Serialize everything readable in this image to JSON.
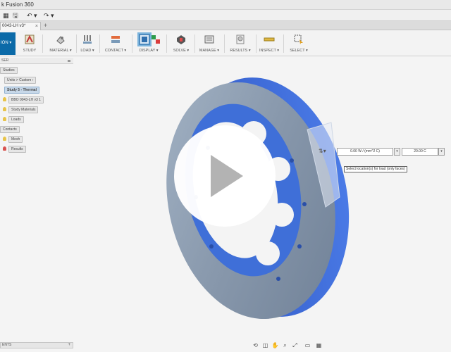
{
  "title": "k Fusion 360",
  "quick_access": {
    "save": "🖫",
    "undo": "↶ ▾",
    "redo": "↷ ▾"
  },
  "document_tab": {
    "label": "0043-LH v3*",
    "close": "×",
    "add": "+"
  },
  "workspace": {
    "label": "ION ▾"
  },
  "toolbar": [
    {
      "label": "STUDY",
      "icon": "study-icon"
    },
    {
      "label": "MATERIAL ▾",
      "icon": "material-icon"
    },
    {
      "label": "LOAD ▾",
      "icon": "load-icon"
    },
    {
      "label": "CONTACT ▾",
      "icon": "contact-icon"
    },
    {
      "label": "DISPLAY ▾",
      "icon": "display-icon",
      "selected": true
    },
    {
      "label": "SOLVE ▾",
      "icon": "solve-icon"
    },
    {
      "label": "MANAGE ▾",
      "icon": "manage-icon"
    },
    {
      "label": "RESULTS ▾",
      "icon": "results-icon"
    },
    {
      "label": "INSPECT ▾",
      "icon": "inspect-icon"
    },
    {
      "label": "SELECT ▾",
      "icon": "select-icon"
    }
  ],
  "browser": {
    "header": "SER",
    "nodes": [
      {
        "label": "Studies"
      },
      {
        "label": "Units > Custom ›"
      },
      {
        "label": "Study 5 - Thermal",
        "selected": true
      },
      {
        "label": "BBO 0043-LH v3 1"
      },
      {
        "label": "Study Materials"
      },
      {
        "label": "Loads"
      },
      {
        "label": "Contacts"
      },
      {
        "label": "Mesh"
      },
      {
        "label": "Results"
      }
    ]
  },
  "load_dialog": {
    "value": "0.00 W / (mm^2 C)",
    "temperature": "20.00 C",
    "dropdown": "▾",
    "tooltip": "Select location(s) for load (only faces)"
  },
  "comments": {
    "label": "ENTS",
    "add": "+"
  },
  "colors": {
    "disc_face": "#8a9db3",
    "disc_blue": "#3f6fd8",
    "accent": "#0b6aa8"
  }
}
